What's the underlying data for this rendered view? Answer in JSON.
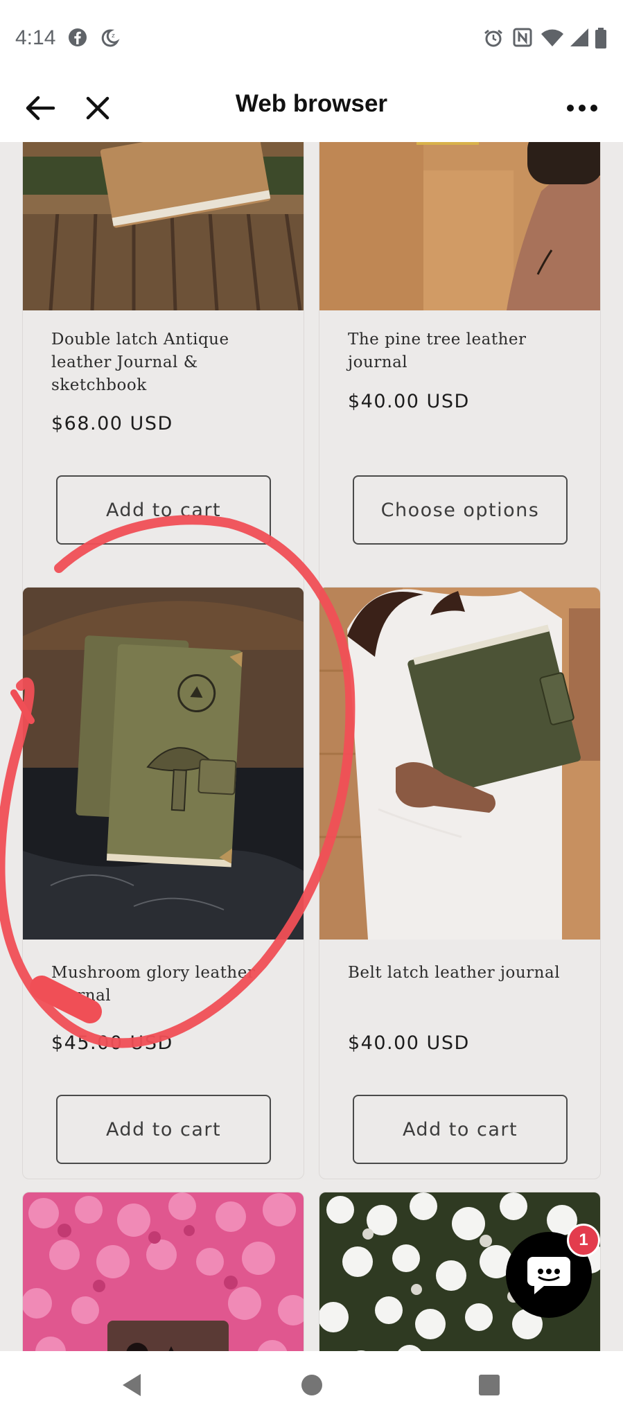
{
  "status_bar": {
    "time": "4:14",
    "left_icons": [
      "facebook-icon",
      "do-not-disturb-icon"
    ],
    "right_icons": [
      "alarm-icon",
      "nfc-icon",
      "wifi-icon",
      "signal-icon",
      "battery-icon"
    ]
  },
  "app_bar": {
    "title": "Web browser",
    "back_icon": "arrow-left-icon",
    "close_icon": "close-icon",
    "menu_icon": "more-horizontal-icon"
  },
  "products": [
    {
      "title": "Double latch Antique leather Journal & sketchbook",
      "price": "$68.00 USD",
      "button": "Add to cart"
    },
    {
      "title": "The pine tree leather journal",
      "price": "$40.00 USD",
      "button": "Choose options"
    },
    {
      "title": "Mushroom glory leather journal",
      "price": "$45.00 USD",
      "button": "Add to cart"
    },
    {
      "title": "Belt latch leather journal",
      "price": "$40.00 USD",
      "button": "Add to cart"
    }
  ],
  "chat": {
    "badge_count": "1",
    "icon": "chat-bubble-icon"
  },
  "nav_bar": {
    "back": "back-triangle-icon",
    "home": "home-circle-icon",
    "recents": "recents-square-icon"
  },
  "colors": {
    "annotation_red": "#f04f56",
    "button_border": "#4a4a4a",
    "page_bg": "#eceae9",
    "badge": "#e33c4d"
  }
}
